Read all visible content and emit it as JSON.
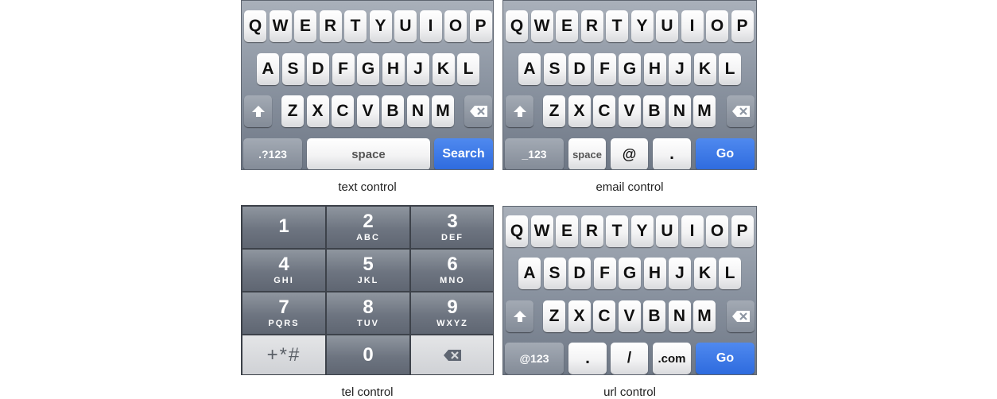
{
  "qwerty_rows": {
    "row1": [
      "Q",
      "W",
      "E",
      "R",
      "T",
      "Y",
      "U",
      "I",
      "O",
      "P"
    ],
    "row2": [
      "A",
      "S",
      "D",
      "F",
      "G",
      "H",
      "J",
      "K",
      "L"
    ],
    "row3": [
      "Z",
      "X",
      "C",
      "V",
      "B",
      "N",
      "M"
    ]
  },
  "text_control": {
    "caption": "text control",
    "numbers_key": ".?123",
    "space_key": "space",
    "action_key": "Search"
  },
  "email_control": {
    "caption": "email control",
    "numbers_key": "_123",
    "space_key": "space",
    "at_key": "@",
    "dot_key": ".",
    "action_key": "Go"
  },
  "tel_control": {
    "caption": "tel control",
    "keys": [
      {
        "num": "1",
        "letters": ""
      },
      {
        "num": "2",
        "letters": "ABC"
      },
      {
        "num": "3",
        "letters": "DEF"
      },
      {
        "num": "4",
        "letters": "GHI"
      },
      {
        "num": "5",
        "letters": "JKL"
      },
      {
        "num": "6",
        "letters": "MNO"
      },
      {
        "num": "7",
        "letters": "PQRS"
      },
      {
        "num": "8",
        "letters": "TUV"
      },
      {
        "num": "9",
        "letters": "WXYZ"
      }
    ],
    "symbols_key": "+*#",
    "zero_key": "0"
  },
  "url_control": {
    "caption": "url control",
    "numbers_key": "@123",
    "dot_key": ".",
    "slash_key": "/",
    "com_key": ".com",
    "action_key": "Go"
  },
  "icons": {
    "shift": "shift-arrow-icon",
    "delete": "backspace-icon"
  },
  "colors": {
    "action_blue": "#2e6bde",
    "keyboard_gray": "#8d96a3"
  }
}
